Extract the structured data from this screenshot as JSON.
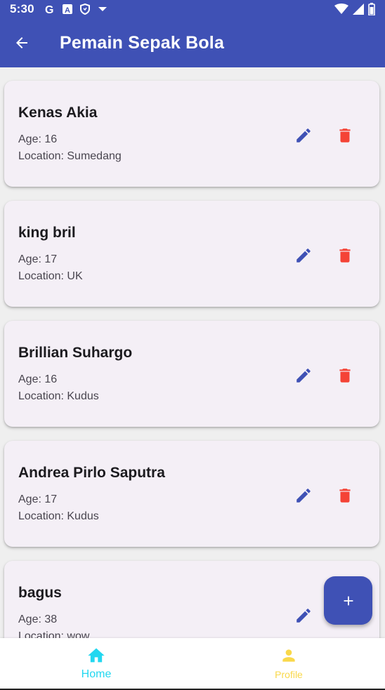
{
  "status_bar": {
    "time": "5:30",
    "icons": [
      "google-g-icon",
      "font-a-icon",
      "shield-icon",
      "dropdown-arrow-icon"
    ],
    "right_icons": [
      "wifi-icon",
      "signal-icon",
      "battery-icon"
    ]
  },
  "app_bar": {
    "title": "Pemain Sepak Bola",
    "back_icon": "arrow-back-icon",
    "background": "#3f51b5"
  },
  "players": [
    {
      "name": "Kenas Akia",
      "age": "Age: 16",
      "location": "Location: Sumedang"
    },
    {
      "name": "king bril",
      "age": "Age: 17",
      "location": "Location: UK"
    },
    {
      "name": "Brillian Suhargo",
      "age": "Age: 16",
      "location": "Location: Kudus"
    },
    {
      "name": "Andrea Pirlo Saputra",
      "age": "Age: 17",
      "location": "Location: Kudus"
    },
    {
      "name": "bagus",
      "age": "Age: 38",
      "location": "Location: wow"
    }
  ],
  "colors": {
    "edit_icon": "#3f51b5",
    "delete_icon": "#f44336",
    "home_active": "#22d7f0",
    "profile": "#f9d84a"
  },
  "fab": {
    "icon": "plus-icon"
  },
  "bottom_nav": {
    "items": [
      {
        "label": "Home",
        "icon": "home-icon"
      },
      {
        "label": "Profile",
        "icon": "person-icon"
      }
    ]
  }
}
